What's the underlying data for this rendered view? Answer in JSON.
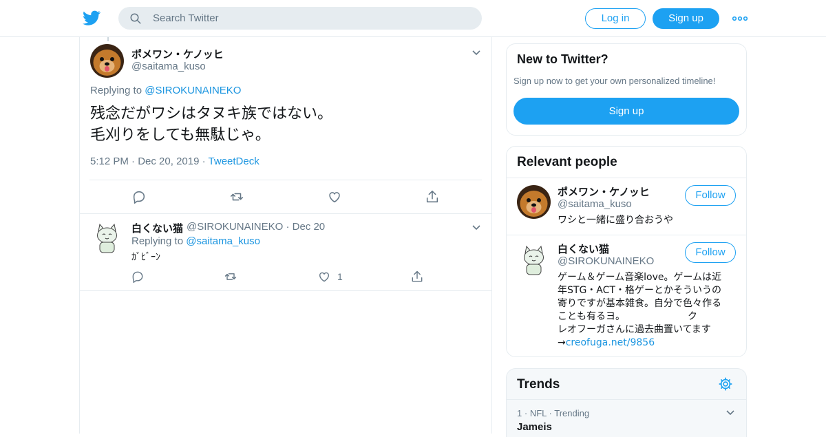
{
  "header": {
    "logo_icon": "twitter-bird-icon",
    "search_placeholder": "Search Twitter",
    "login_label": "Log in",
    "signup_label": "Sign up",
    "more_icon": "more-dots-icon"
  },
  "main_tweet": {
    "display_name": "ポメワン・ケノッヒ",
    "handle": "@saitama_kuso",
    "replying_prefix": "Replying to",
    "replying_to": "@SIROKUNAINEKO",
    "text_line1": "残念だがワシはタヌキ族ではない。",
    "text_line2": "毛刈りをしても無駄じゃ。",
    "time": "5:12 PM",
    "date": "Dec 20, 2019",
    "source": "TweetDeck",
    "separator": "·"
  },
  "reply_tweet": {
    "display_name": "白くない猫",
    "handle": "@SIROKUNAINEKO",
    "separator": "·",
    "date": "Dec 20",
    "replying_prefix": "Replying to",
    "replying_to": "@saitama_kuso",
    "text": "ｶﾞﾋﾞｰﾝ",
    "like_count": "1"
  },
  "new_to_twitter": {
    "title": "New to Twitter?",
    "subtitle": "Sign up now to get your own personalized timeline!",
    "signup_label": "Sign up"
  },
  "relevant_people": {
    "title": "Relevant people",
    "people": [
      {
        "display_name": "ポメワン・ケノッヒ",
        "handle": "@saitama_kuso",
        "follow_label": "Follow",
        "bio": "ワシと一緒に盛り合おうや"
      },
      {
        "display_name": "白くない猫",
        "handle": "@SIROKUNAINEKO",
        "follow_label": "Follow",
        "bio_line1": "ゲーム＆ゲーム音楽love。ゲームは近",
        "bio_line2": "年STG・ACT・格ゲーとかそういうの",
        "bio_line3": "寄りですが基本雑食。自分で色々作る",
        "bio_line4": "ことも有るヨ。　　　　　　　ク",
        "bio_line5": "レオフーガさんに過去曲置いてます",
        "bio_arrow": "→",
        "bio_link": "creofuga.net/9856"
      }
    ]
  },
  "trends": {
    "title": "Trends",
    "settings_icon": "gear-icon",
    "items": [
      {
        "rank": "1",
        "category": "NFL",
        "status": "Trending",
        "name": "Jameis",
        "separator": "·"
      }
    ]
  },
  "colors": {
    "brand_blue": "#1da1f2",
    "link_blue": "#1b95e0",
    "muted_text": "#657786",
    "border": "#e6ecf0"
  }
}
